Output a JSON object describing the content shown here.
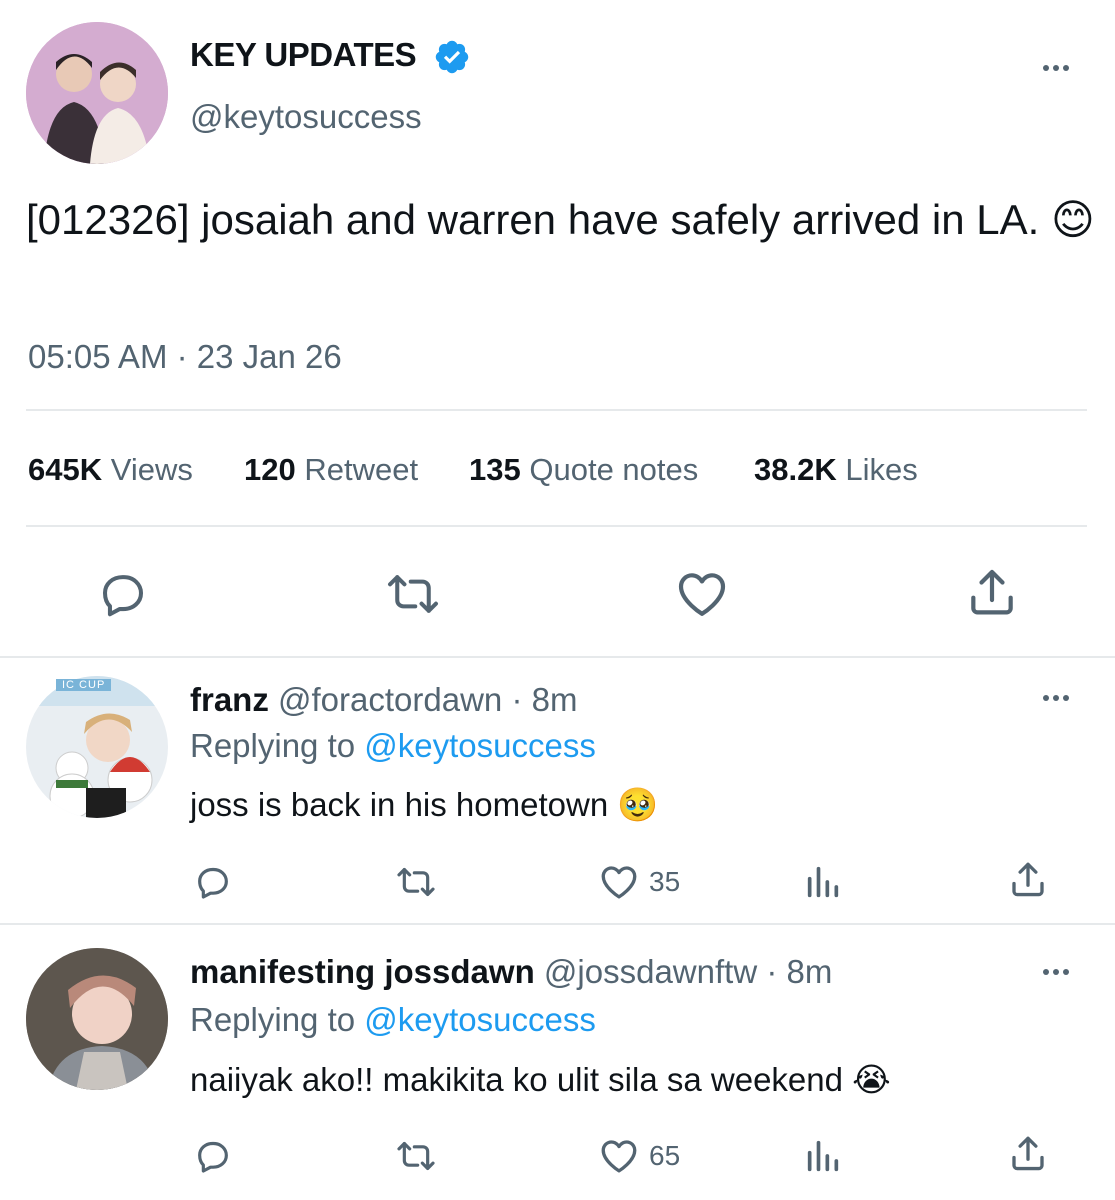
{
  "main_tweet": {
    "display_name": "KEY UPDATES",
    "handle": "@keytosuccess",
    "text": "[012326] josaiah and warren have safely arrived in LA.",
    "emoji": "😊",
    "time": "05:05 AM",
    "separator": "·",
    "date": "23 Jan 26",
    "stats": {
      "views_num": "645K",
      "views_label": "Views",
      "retweets_num": "120",
      "retweets_label": "Retweet",
      "quotes_num": "135",
      "quotes_label": "Quote notes",
      "likes_num": "38.2K",
      "likes_label": "Likes"
    },
    "icons": [
      "reply-icon",
      "retweet-icon",
      "like-icon",
      "share-icon"
    ]
  },
  "replies": [
    {
      "display_name": "franz",
      "handle": "@foractordawn",
      "time": "· 8m",
      "replying_prefix": "Replying to",
      "replying_handle": "@keytosuccess",
      "text": "joss is back in his hometown",
      "emoji": "🥹",
      "like_count": "35",
      "avatar_text": "IC CUP"
    },
    {
      "display_name": "manifesting jossdawn",
      "handle": "@jossdawnftw",
      "time": "· 8m",
      "replying_prefix": "Replying to",
      "replying_handle": "@keytosuccess",
      "text": "naiiyak ako!! makikita ko ulit sila sa weekend",
      "emoji": "😭",
      "like_count": "65"
    }
  ],
  "colors": {
    "accent": "#1d9bf0",
    "text_primary": "#0f1419",
    "text_secondary": "#536471",
    "divider": "#e6e9eb"
  }
}
